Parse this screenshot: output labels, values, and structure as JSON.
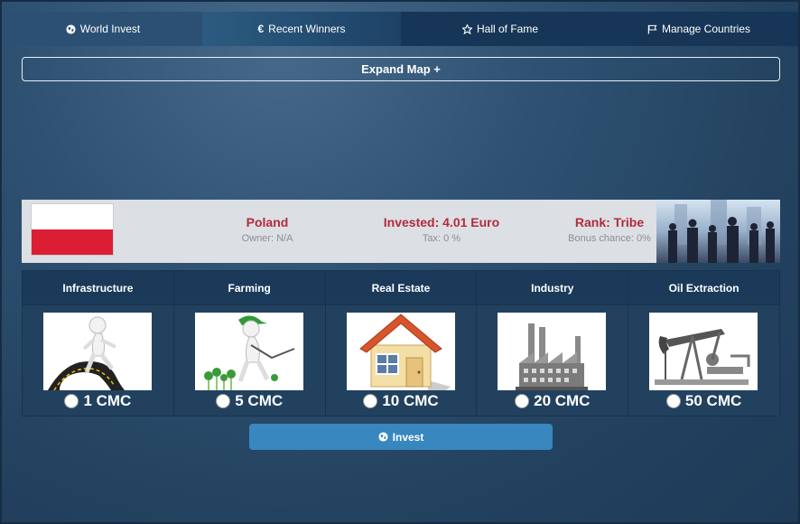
{
  "tabs": [
    {
      "label": "World Invest",
      "icon": "globe-icon"
    },
    {
      "label": "Recent Winners",
      "icon": "euro-icon"
    },
    {
      "label": "Hall of Fame",
      "icon": "star-icon"
    },
    {
      "label": "Manage Countries",
      "icon": "flag-icon"
    }
  ],
  "map": {
    "expand_label": "Expand Map +"
  },
  "country": {
    "name": "Poland",
    "owner": "Owner: N/A",
    "invested": "Invested: 4.01 Euro",
    "tax": "Tax: 0 %",
    "rank": "Rank: Tribe",
    "bonus": "Bonus chance: 0%",
    "flag_colors": [
      "#ffffff",
      "#dc1e35"
    ]
  },
  "sectors": [
    {
      "name": "Infrastructure",
      "amount": "1 CMC",
      "icon": "road-icon"
    },
    {
      "name": "Farming",
      "amount": "5 CMC",
      "icon": "farmer-icon"
    },
    {
      "name": "Real Estate",
      "amount": "10 CMC",
      "icon": "house-icon"
    },
    {
      "name": "Industry",
      "amount": "20 CMC",
      "icon": "factory-icon"
    },
    {
      "name": "Oil Extraction",
      "amount": "50 CMC",
      "icon": "oil-pump-icon"
    }
  ],
  "invest_button": {
    "label": "Invest",
    "color": "#3887bf"
  }
}
